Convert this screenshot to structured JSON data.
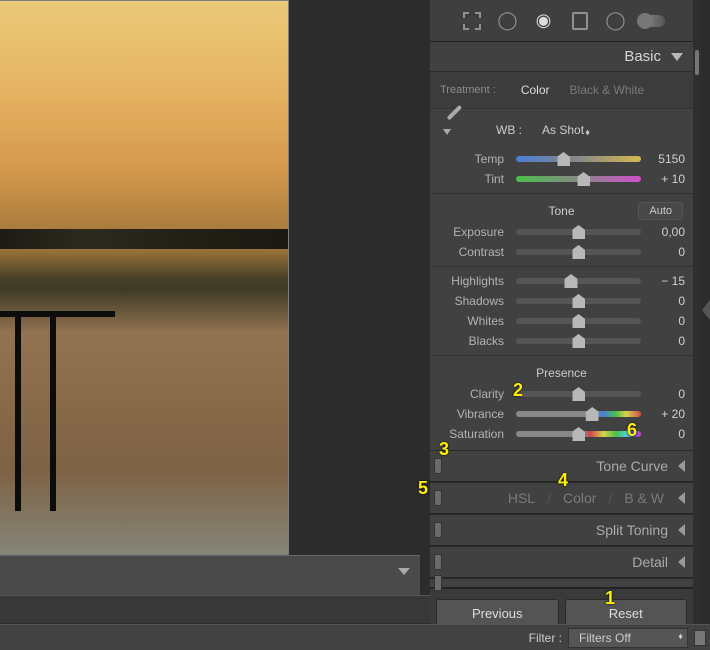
{
  "panel_title": "Basic",
  "treatment": {
    "label": "Treatment :",
    "color": "Color",
    "bw": "Black & White"
  },
  "wb": {
    "label": "WB :",
    "value": "As Shot"
  },
  "sliders": {
    "temp": {
      "label": "Temp",
      "value": "5150",
      "pos": 38
    },
    "tint": {
      "label": "Tint",
      "value": "+ 10",
      "pos": 54
    },
    "exposure": {
      "label": "Exposure",
      "value": "0,00",
      "pos": 50
    },
    "contrast": {
      "label": "Contrast",
      "value": "0",
      "pos": 50
    },
    "highlights": {
      "label": "Highlights",
      "value": "− 15",
      "pos": 44
    },
    "shadows": {
      "label": "Shadows",
      "value": "0",
      "pos": 50
    },
    "whites": {
      "label": "Whites",
      "value": "0",
      "pos": 50
    },
    "blacks": {
      "label": "Blacks",
      "value": "0",
      "pos": 50
    },
    "clarity": {
      "label": "Clarity",
      "value": "0",
      "pos": 50
    },
    "vibrance": {
      "label": "Vibrance",
      "value": "+ 20",
      "pos": 61
    },
    "saturation": {
      "label": "Saturation",
      "value": "0",
      "pos": 50
    }
  },
  "sections": {
    "tone": "Tone",
    "presence": "Presence",
    "auto": "Auto"
  },
  "subpanels": {
    "tonecurve": "Tone Curve",
    "hsl": "HSL",
    "color": "Color",
    "bw": "B & W",
    "split": "Split Toning",
    "detail": "Detail"
  },
  "buttons": {
    "previous": "Previous",
    "reset": "Reset"
  },
  "filter": {
    "label": "Filter :",
    "value": "Filters Off"
  },
  "annotations": {
    "a1": "1",
    "a2": "2",
    "a3": "3",
    "a4": "4",
    "a5": "5",
    "a6": "6"
  }
}
